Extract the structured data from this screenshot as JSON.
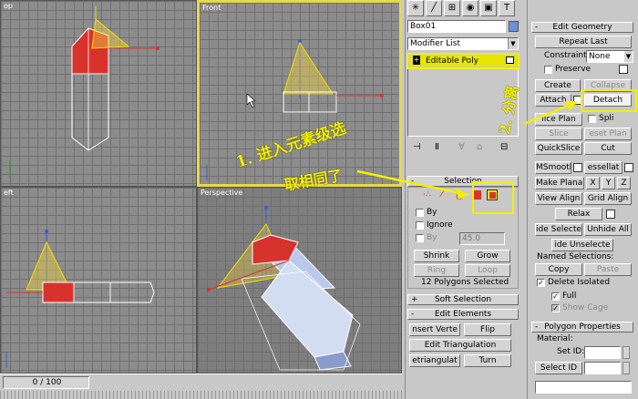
{
  "viewports": {
    "top": {
      "label": "op"
    },
    "front": {
      "label": "Front"
    },
    "left": {
      "label": "eft"
    },
    "perspective": {
      "label": "Perspective"
    }
  },
  "timeline": {
    "frame": "0 / 100"
  },
  "command_panel": {
    "tabs": [
      "create-icon",
      "modify-icon",
      "hierarchy-icon",
      "motion-icon",
      "display-icon",
      "utilities-icon"
    ],
    "object_name": "Box01",
    "object_color": "#6f8fd8",
    "modifier_list": "Modifier List",
    "stack_item": "Editable Poly",
    "stack_sign": "+"
  },
  "selection": {
    "header": "Selection",
    "header_sign": "-",
    "by_vertex_label": "By",
    "ignore_label": "Ignore",
    "by_angle_label": "By",
    "angle_value": "45.0",
    "shrink": "Shrink",
    "grow": "Grow",
    "ring": "Ring",
    "loop": "Loop",
    "status": "12 Polygons Selected"
  },
  "soft_selection": {
    "header": "Soft Selection",
    "sign": "+"
  },
  "edit_elements": {
    "header": "Edit Elements",
    "sign": "-",
    "insert_vertex": "nsert Verte",
    "flip": "Flip",
    "edit_triangulation": "Edit Triangulation",
    "retriangulate": "etriangulat",
    "turn": "Turn"
  },
  "edit_geometry": {
    "header": "Edit Geometry",
    "sign": "-",
    "repeat_last": "Repeat Last",
    "constraints_label": "Constraints:",
    "constraints_value": "None",
    "preserve": "Preserve",
    "create": "Create",
    "collapse": "Collapse",
    "attach": "Attach",
    "detach": "Detach",
    "slice_plane": "lice Plan",
    "split": "Spli",
    "slice": "Slice",
    "reset_plane": "eset Plan",
    "quickslice": "QuickSlice",
    "cut": "Cut",
    "msmooth": "MSmooth",
    "tessellate": "essellat",
    "make_planar": "Make Planar",
    "x": "X",
    "y": "Y",
    "z": "Z",
    "view_align": "View Align",
    "grid_align": "Grid Align",
    "relax": "Relax",
    "hide_selected": "ide Selecte",
    "unhide_all": "Unhide All",
    "hide_unselected": "ide Unselecte",
    "named_selections": "Named Selections:",
    "copy": "Copy",
    "paste": "Paste",
    "delete_isolated": "Delete Isolated",
    "full": "Full",
    "show_cage": "Show Cage"
  },
  "polygon_properties": {
    "header": "Polygon Properties",
    "sign": "-",
    "material": "Material:",
    "set_id": "Set ID:",
    "select_id": "Select ID"
  },
  "annotations": {
    "note1": "1. 进入元素级选",
    "note1b": "取相同了",
    "note2": "2. 分离"
  },
  "colors": {
    "accent_yellow": "#f4f000",
    "active_viewport": "#e6d94a",
    "selected_red": "#d8322c",
    "stack_highlight": "#e6e600"
  }
}
